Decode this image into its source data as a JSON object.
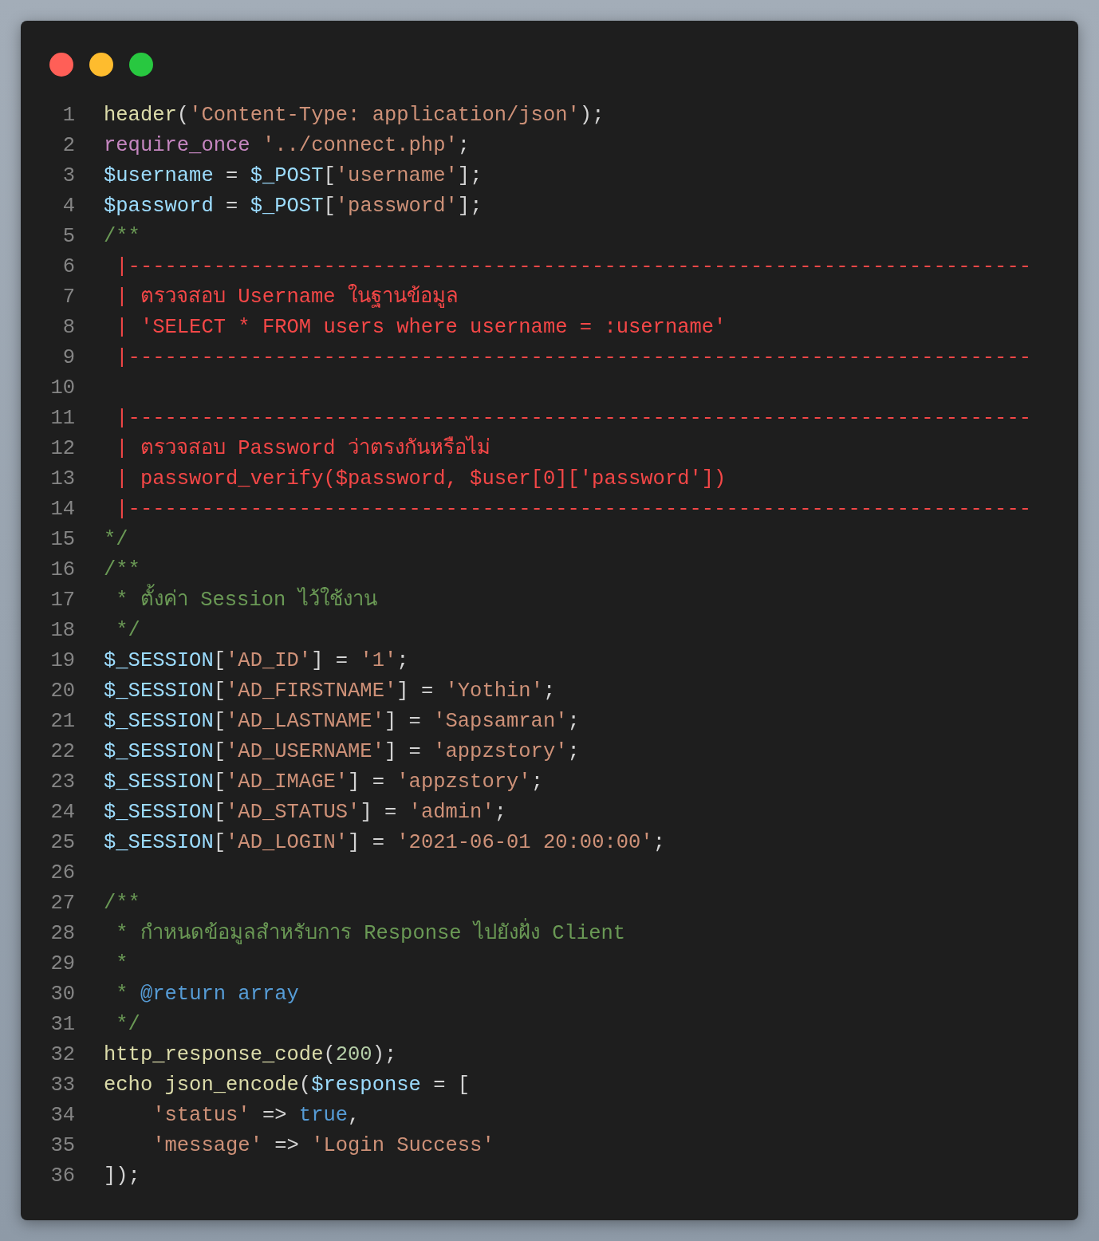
{
  "window_controls": [
    {
      "color": "#ff5f57"
    },
    {
      "color": "#febc2e"
    },
    {
      "color": "#28c840"
    }
  ],
  "lines": [
    {
      "number": "1",
      "tokens": [
        {
          "kind": "fn",
          "text": "header"
        },
        {
          "kind": "punct",
          "text": "("
        },
        {
          "kind": "str",
          "text": "'Content-Type: application/json'"
        },
        {
          "kind": "punct",
          "text": ");"
        }
      ]
    },
    {
      "number": "2",
      "tokens": [
        {
          "kind": "kw",
          "text": "require_once "
        },
        {
          "kind": "str",
          "text": "'../connect.php'"
        },
        {
          "kind": "punct",
          "text": ";"
        }
      ]
    },
    {
      "number": "3",
      "tokens": [
        {
          "kind": "var",
          "text": "$username"
        },
        {
          "kind": "punct",
          "text": " = "
        },
        {
          "kind": "var",
          "text": "$_POST"
        },
        {
          "kind": "punct",
          "text": "["
        },
        {
          "kind": "str",
          "text": "'username'"
        },
        {
          "kind": "punct",
          "text": "];"
        }
      ]
    },
    {
      "number": "4",
      "tokens": [
        {
          "kind": "var",
          "text": "$password"
        },
        {
          "kind": "punct",
          "text": " = "
        },
        {
          "kind": "var",
          "text": "$_POST"
        },
        {
          "kind": "punct",
          "text": "["
        },
        {
          "kind": "str",
          "text": "'password'"
        },
        {
          "kind": "punct",
          "text": "];"
        }
      ]
    },
    {
      "number": "5",
      "tokens": [
        {
          "kind": "comment",
          "text": "/**"
        }
      ]
    },
    {
      "number": "6",
      "tokens": [
        {
          "kind": "alert",
          "text": " |--------------------------------------------------------------------------"
        }
      ]
    },
    {
      "number": "7",
      "tokens": [
        {
          "kind": "alert",
          "text": " | ตรวจสอบ Username ในฐานข้อมูล"
        }
      ]
    },
    {
      "number": "8",
      "tokens": [
        {
          "kind": "alert",
          "text": " | 'SELECT * FROM users where username = :username'"
        }
      ]
    },
    {
      "number": "9",
      "tokens": [
        {
          "kind": "alert",
          "text": " |--------------------------------------------------------------------------"
        }
      ]
    },
    {
      "number": "10"
    },
    {
      "number": "11",
      "tokens": [
        {
          "kind": "alert",
          "text": " |--------------------------------------------------------------------------"
        }
      ]
    },
    {
      "number": "12",
      "tokens": [
        {
          "kind": "alert",
          "text": " | ตรวจสอบ Password ว่าตรงกันหรือไม่"
        }
      ]
    },
    {
      "number": "13",
      "tokens": [
        {
          "kind": "alert",
          "text": " | password_verify($password, $user[0]['password'])"
        }
      ]
    },
    {
      "number": "14",
      "tokens": [
        {
          "kind": "alert",
          "text": " |--------------------------------------------------------------------------"
        }
      ]
    },
    {
      "number": "15",
      "tokens": [
        {
          "kind": "comment",
          "text": "*/"
        }
      ]
    },
    {
      "number": "16",
      "tokens": [
        {
          "kind": "comment",
          "text": "/**"
        }
      ]
    },
    {
      "number": "17",
      "tokens": [
        {
          "kind": "comment",
          "text": " * ตั้งค่า Session ไว้ใช้งาน"
        }
      ]
    },
    {
      "number": "18",
      "tokens": [
        {
          "kind": "comment",
          "text": " */"
        }
      ]
    },
    {
      "number": "19",
      "tokens": [
        {
          "kind": "var",
          "text": "$_SESSION"
        },
        {
          "kind": "punct",
          "text": "["
        },
        {
          "kind": "str",
          "text": "'AD_ID'"
        },
        {
          "kind": "punct",
          "text": "] = "
        },
        {
          "kind": "str",
          "text": "'1'"
        },
        {
          "kind": "punct",
          "text": ";"
        }
      ]
    },
    {
      "number": "20",
      "tokens": [
        {
          "kind": "var",
          "text": "$_SESSION"
        },
        {
          "kind": "punct",
          "text": "["
        },
        {
          "kind": "str",
          "text": "'AD_FIRSTNAME'"
        },
        {
          "kind": "punct",
          "text": "] = "
        },
        {
          "kind": "str",
          "text": "'Yothin'"
        },
        {
          "kind": "punct",
          "text": ";"
        }
      ]
    },
    {
      "number": "21",
      "tokens": [
        {
          "kind": "var",
          "text": "$_SESSION"
        },
        {
          "kind": "punct",
          "text": "["
        },
        {
          "kind": "str",
          "text": "'AD_LASTNAME'"
        },
        {
          "kind": "punct",
          "text": "] = "
        },
        {
          "kind": "str",
          "text": "'Sapsamran'"
        },
        {
          "kind": "punct",
          "text": ";"
        }
      ]
    },
    {
      "number": "22",
      "tokens": [
        {
          "kind": "var",
          "text": "$_SESSION"
        },
        {
          "kind": "punct",
          "text": "["
        },
        {
          "kind": "str",
          "text": "'AD_USERNAME'"
        },
        {
          "kind": "punct",
          "text": "] = "
        },
        {
          "kind": "str",
          "text": "'appzstory'"
        },
        {
          "kind": "punct",
          "text": ";"
        }
      ]
    },
    {
      "number": "23",
      "tokens": [
        {
          "kind": "var",
          "text": "$_SESSION"
        },
        {
          "kind": "punct",
          "text": "["
        },
        {
          "kind": "str",
          "text": "'AD_IMAGE'"
        },
        {
          "kind": "punct",
          "text": "] = "
        },
        {
          "kind": "str",
          "text": "'appzstory'"
        },
        {
          "kind": "punct",
          "text": ";"
        }
      ]
    },
    {
      "number": "24",
      "tokens": [
        {
          "kind": "var",
          "text": "$_SESSION"
        },
        {
          "kind": "punct",
          "text": "["
        },
        {
          "kind": "str",
          "text": "'AD_STATUS'"
        },
        {
          "kind": "punct",
          "text": "] = "
        },
        {
          "kind": "str",
          "text": "'admin'"
        },
        {
          "kind": "punct",
          "text": ";"
        }
      ]
    },
    {
      "number": "25",
      "tokens": [
        {
          "kind": "var",
          "text": "$_SESSION"
        },
        {
          "kind": "punct",
          "text": "["
        },
        {
          "kind": "str",
          "text": "'AD_LOGIN'"
        },
        {
          "kind": "punct",
          "text": "] = "
        },
        {
          "kind": "str",
          "text": "'2021-06-01 20:00:00'"
        },
        {
          "kind": "punct",
          "text": ";"
        }
      ]
    },
    {
      "number": "26"
    },
    {
      "number": "27",
      "tokens": [
        {
          "kind": "comment",
          "text": "/**"
        }
      ]
    },
    {
      "number": "28",
      "tokens": [
        {
          "kind": "comment",
          "text": " * กำหนดข้อมูลสำหรับการ Response ไปยังฝั่ง Client"
        }
      ]
    },
    {
      "number": "29",
      "tokens": [
        {
          "kind": "comment",
          "text": " *"
        }
      ]
    },
    {
      "number": "30",
      "tokens": [
        {
          "kind": "comment",
          "text": " * "
        },
        {
          "kind": "tag",
          "text": "@return array"
        }
      ]
    },
    {
      "number": "31",
      "tokens": [
        {
          "kind": "comment",
          "text": " */"
        }
      ]
    },
    {
      "number": "32",
      "tokens": [
        {
          "kind": "fn",
          "text": "http_response_code"
        },
        {
          "kind": "punct",
          "text": "("
        },
        {
          "kind": "num",
          "text": "200"
        },
        {
          "kind": "punct",
          "text": ");"
        }
      ]
    },
    {
      "number": "33",
      "tokens": [
        {
          "kind": "fn",
          "text": "echo json_encode"
        },
        {
          "kind": "punct",
          "text": "("
        },
        {
          "kind": "var",
          "text": "$response"
        },
        {
          "kind": "punct",
          "text": " = ["
        }
      ]
    },
    {
      "number": "34",
      "tokens": [
        {
          "kind": "str",
          "text": "    'status'"
        },
        {
          "kind": "punct",
          "text": " => "
        },
        {
          "kind": "const",
          "text": "true"
        },
        {
          "kind": "punct",
          "text": ","
        }
      ]
    },
    {
      "number": "35",
      "tokens": [
        {
          "kind": "str",
          "text": "    'message'"
        },
        {
          "kind": "punct",
          "text": " => "
        },
        {
          "kind": "str",
          "text": "'Login Success'"
        }
      ]
    },
    {
      "number": "36",
      "tokens": [
        {
          "kind": "punct",
          "text": "]);"
        }
      ]
    }
  ]
}
